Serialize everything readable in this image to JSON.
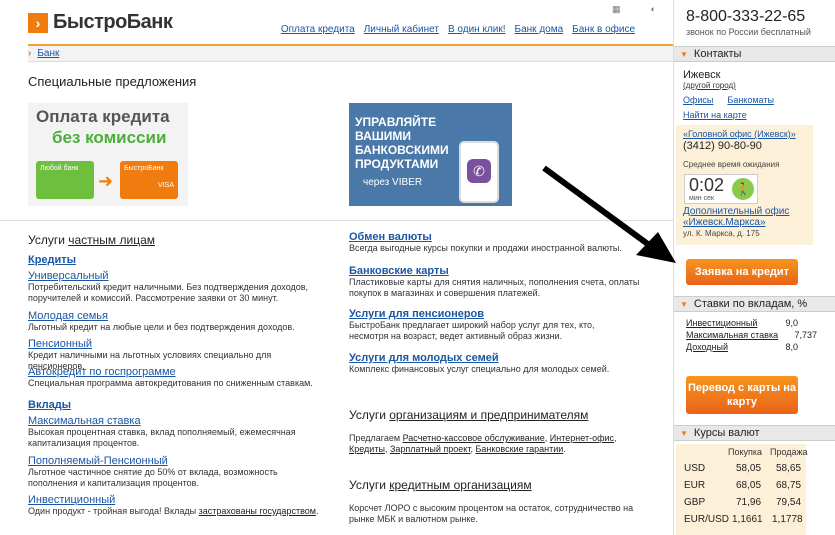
{
  "header": {
    "logo_text": "БыстроБанк",
    "nav": [
      "Оплата кредита",
      "Личный кабинет",
      "В один клик!",
      "Банк дома",
      "Банк в офисе"
    ],
    "phone": "8-800-333-22-65",
    "phone_sub": "звонок по России бесплатный"
  },
  "breadcrumb": "Банк",
  "special": {
    "title": "Специальные предложения",
    "banner1": {
      "line1": "Оплата кредита",
      "line2": "без комиссии",
      "card1": "Любой банк",
      "card2": "БыстроБанк",
      "visa": "VISA"
    },
    "banner2": {
      "text": "УПРАВЛЯЙТЕ ВАШИМИ БАНКОВСКИМИ ПРОДУКТАМИ",
      "via": "через VIBER"
    }
  },
  "private": {
    "title_prefix": "Услуги",
    "title_link": "частным лицам",
    "credits": {
      "title": "Кредиты",
      "items": [
        {
          "name": "Универсальный",
          "desc": "Потребительский кредит наличными. Без подтверждения доходов, поручителей и комиссий. Рассмотрение заявки от 30 минут."
        },
        {
          "name": "Молодая семья",
          "desc": "Льготный кредит на любые цели и без подтверждения доходов."
        },
        {
          "name": "Пенсионный",
          "desc": "Кредит наличными на льготных условиях специально для пенсионеров."
        },
        {
          "name": "Автокредит по госпрограмме",
          "desc": "Специальная программа автокредитования по сниженным ставкам."
        }
      ]
    },
    "deposits": {
      "title": "Вклады",
      "items": [
        {
          "name": "Максимальная ставка",
          "desc": "Высокая процентная ставка, вклад пополняемый, ежемесячная капитализация процентов."
        },
        {
          "name": "Пополняемый-Пенсионный",
          "desc": "Льготное частичное снятие до 50% от вклада, возможность пополнения и капитализация процентов."
        },
        {
          "name": "Инвестиционный",
          "desc": "Один продукт -  тройная выгода!   Вклады",
          "desc_link": "застрахованы государством",
          "desc_end": "."
        }
      ]
    }
  },
  "middle": {
    "items": [
      {
        "name": "Обмен валюты",
        "desc": "Всегда выгодные курсы покупки и продажи иностранной валюты."
      },
      {
        "name": "Банковские карты",
        "desc": "Пластиковые карты для снятия наличных, пополнения счета, оплаты покупок в магазинах и совершения платежей."
      },
      {
        "name": "Услуги для пенсионеров",
        "desc": "БыстроБанк предлагает широкий набор услуг для тех, кто, несмотря на возраст, ведет активный образ жизни."
      },
      {
        "name": "Услуги для молодых семей",
        "desc": "Комплекс финансовых услуг специально для молодых семей."
      }
    ],
    "org": {
      "title_prefix": "Услуги",
      "title_link": "организациям и предпринимателям",
      "lead": "Предлагаем",
      "links": [
        "Расчетно-кассовое обслуживание",
        "Интернет-офис",
        "Кредиты",
        "Зарплатный проект",
        "Банковские гарантии"
      ]
    },
    "credit_org": {
      "title_prefix": "Услуги",
      "title_link": "кредитным организациям",
      "desc": "Корсчет ЛОРО с высоким процентом на остаток, сотрудничество на рынке МБК и валютном рынке."
    }
  },
  "sidebar": {
    "contacts_title": "Контакты",
    "city": "Ижевск",
    "other_city": "(другой город)",
    "offices": "Офисы",
    "atms": "Банкоматы",
    "map": "Найти на карте",
    "head_office": "«Головной офис (Ижевск)»",
    "head_phone": "(3412) 90-80-90",
    "wait_label": "Среднее время ожидания",
    "timer": "0:02",
    "timer_units": "мин   сек",
    "extra_office": "Дополнительный офис «Ижевск.Маркса»",
    "extra_addr": "ул. К. Маркса, д. 175",
    "apply_btn": "Заявка на кредит",
    "rates_title": "Ставки по вкладам, %",
    "rates": [
      {
        "name": "Инвестиционный",
        "value": "9,0"
      },
      {
        "name": "Максимальная ставка",
        "value": "7,737"
      },
      {
        "name": "Доходный",
        "value": "8,0"
      }
    ],
    "transfer_btn": "Перевод с карты на карту",
    "fx_title": "Курсы валют",
    "fx_buy": "Покупка",
    "fx_sell": "Продажа",
    "fx": [
      {
        "cur": "USD",
        "buy": "58,05",
        "sell": "58,65"
      },
      {
        "cur": "EUR",
        "buy": "68,05",
        "sell": "68,75"
      },
      {
        "cur": "GBP",
        "buy": "71,96",
        "sell": "79,54"
      },
      {
        "cur": "EUR/USD",
        "buy": "1,1661",
        "sell": "1,1778"
      }
    ]
  }
}
